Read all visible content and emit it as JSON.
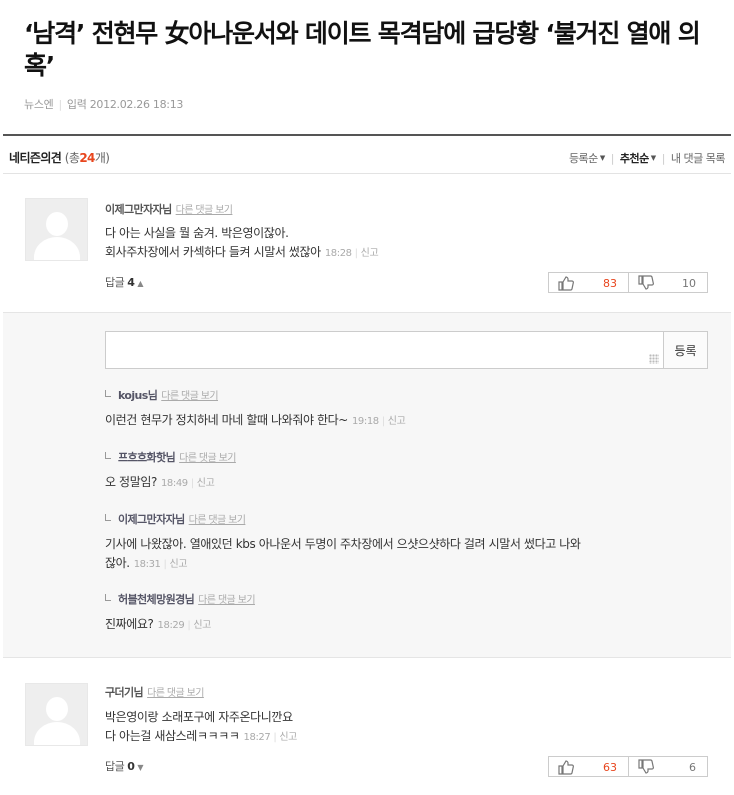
{
  "article": {
    "headline": "‘남격’ 전현무 女아나운서와 데이트 목격담에 급당황 ‘불거진 열애 의혹’",
    "source": "뉴스엔",
    "date_label": "입력",
    "date": "2012.02.26 18:13"
  },
  "comments_header": {
    "title": "네티즌의견",
    "count_prefix": "(총",
    "count": "24",
    "count_suffix": "개)",
    "sort_latest": "등록순",
    "sort_recommended": "추천순",
    "my_comments": "내 댓글 목록"
  },
  "comments": [
    {
      "nick": "이제그만자자님",
      "reply_link": "다른 댓글 보기",
      "line1": "다 아는 사실을 뭘 숨겨. 박은영이잖아.",
      "line2": "회사주차장에서 카섹하다 들켜 시말서 썼잖아",
      "time": "18:28",
      "report": "신고",
      "reply_label": "답글",
      "reply_count": "4",
      "up": "83",
      "down": "10"
    },
    {
      "nick": "구더기님",
      "reply_link": "다른 댓글 보기",
      "line1": "박은영이랑 소래포구에 자주온다니깐요",
      "line2": "다 아는걸 새삼스레ㅋㅋㅋㅋ",
      "time": "18:27",
      "report": "신고",
      "reply_label": "답글",
      "reply_count": "0",
      "up": "63",
      "down": "6"
    }
  ],
  "reply_form": {
    "submit": "등록"
  },
  "replies": [
    {
      "nick": "kojus님",
      "reply_link": "다른 댓글 보기",
      "text": "이런건 현무가 정치하네 마네 할때 나와줘야 한다~",
      "text2": "",
      "time": "19:18",
      "report": "신고"
    },
    {
      "nick": "프흐흐화핫님",
      "reply_link": "다른 댓글 보기",
      "text": "오 정말임?",
      "text2": "",
      "time": "18:49",
      "report": "신고"
    },
    {
      "nick": "이제그만자자님",
      "reply_link": "다른 댓글 보기",
      "text": "기사에 나왔잖아. 열애있던 kbs 아나운서 두명이 주차장에서 으샷으샷하다 걸려 시말서 썼다고 나와",
      "text2": "잖아.",
      "time": "18:31",
      "report": "신고"
    },
    {
      "nick": "허블천체망원경님",
      "reply_link": "다른 댓글 보기",
      "text": "진짜에요?",
      "text2": "",
      "time": "18:29",
      "report": "신고"
    }
  ],
  "colors": {
    "accent": "#e8461e",
    "border_dark": "#555555",
    "reply_bg": "#f7f7f7"
  },
  "icons": {
    "up": "thumbs-up-icon",
    "down": "thumbs-down-icon",
    "avatar": "default-avatar-icon"
  }
}
